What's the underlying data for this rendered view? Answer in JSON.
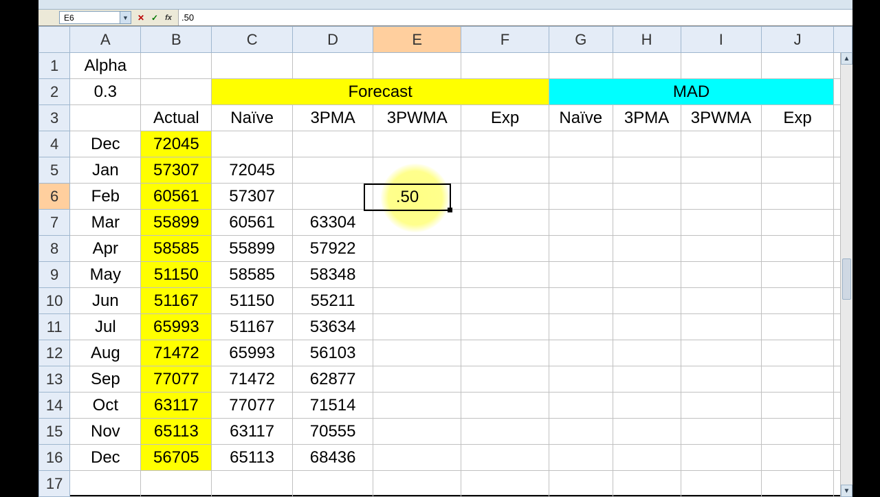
{
  "formula_bar": {
    "name_box": "E6",
    "cancel_icon": "✕",
    "accept_icon": "✓",
    "fx_icon": "fx",
    "formula_text": ".50"
  },
  "active": {
    "cell_ref": "E6",
    "display_value": ".50",
    "col_index": 5,
    "row_index": 6
  },
  "columns": [
    "A",
    "B",
    "C",
    "D",
    "E",
    "F",
    "G",
    "H",
    "I",
    "J"
  ],
  "row_numbers": [
    1,
    2,
    3,
    4,
    5,
    6,
    7,
    8,
    9,
    10,
    11,
    12,
    13,
    14,
    15,
    16,
    17
  ],
  "merged_headers": {
    "forecast": {
      "label": "Forecast",
      "from_col": "C",
      "to_col": "F",
      "bg": "yellow"
    },
    "mad": {
      "label": "MAD",
      "from_col": "G",
      "to_col": "J",
      "bg": "cyan"
    }
  },
  "cells": {
    "A1": "Alpha",
    "A2": "0.3",
    "B3": "Actual",
    "C3": "Naïve",
    "D3": "3PMA",
    "E3": "3PWMA",
    "F3": "Exp",
    "G3": "Naïve",
    "H3": "3PMA",
    "I3": "3PWMA",
    "J3": "Exp",
    "A4": "Dec",
    "B4": "72045",
    "A5": "Jan",
    "B5": "57307",
    "C5": "72045",
    "A6": "Feb",
    "B6": "60561",
    "C6": "57307",
    "A7": "Mar",
    "B7": "55899",
    "C7": "60561",
    "D7": "63304",
    "A8": "Apr",
    "B8": "58585",
    "C8": "55899",
    "D8": "57922",
    "A9": "May",
    "B9": "51150",
    "C9": "58585",
    "D9": "58348",
    "A10": "Jun",
    "B10": "51167",
    "C10": "51150",
    "D10": "55211",
    "A11": "Jul",
    "B11": "65993",
    "C11": "51167",
    "D11": "53634",
    "A12": "Aug",
    "B12": "71472",
    "C12": "65993",
    "D12": "56103",
    "A13": "Sep",
    "B13": "77077",
    "C13": "71472",
    "D13": "62877",
    "A14": "Oct",
    "B14": "63117",
    "C14": "77077",
    "D14": "71514",
    "A15": "Nov",
    "B15": "65113",
    "C15": "63117",
    "D15": "70555",
    "A16": "Dec",
    "B16": "56705",
    "C16": "65113",
    "D16": "68436"
  },
  "highlights": {
    "yellow_cells": [
      "B4",
      "B5",
      "B6",
      "B7",
      "B8",
      "B9",
      "B10",
      "B11",
      "B12",
      "B13",
      "B14",
      "B15",
      "B16"
    ]
  },
  "scrollbar": {
    "up": "▲",
    "down": "▼"
  }
}
